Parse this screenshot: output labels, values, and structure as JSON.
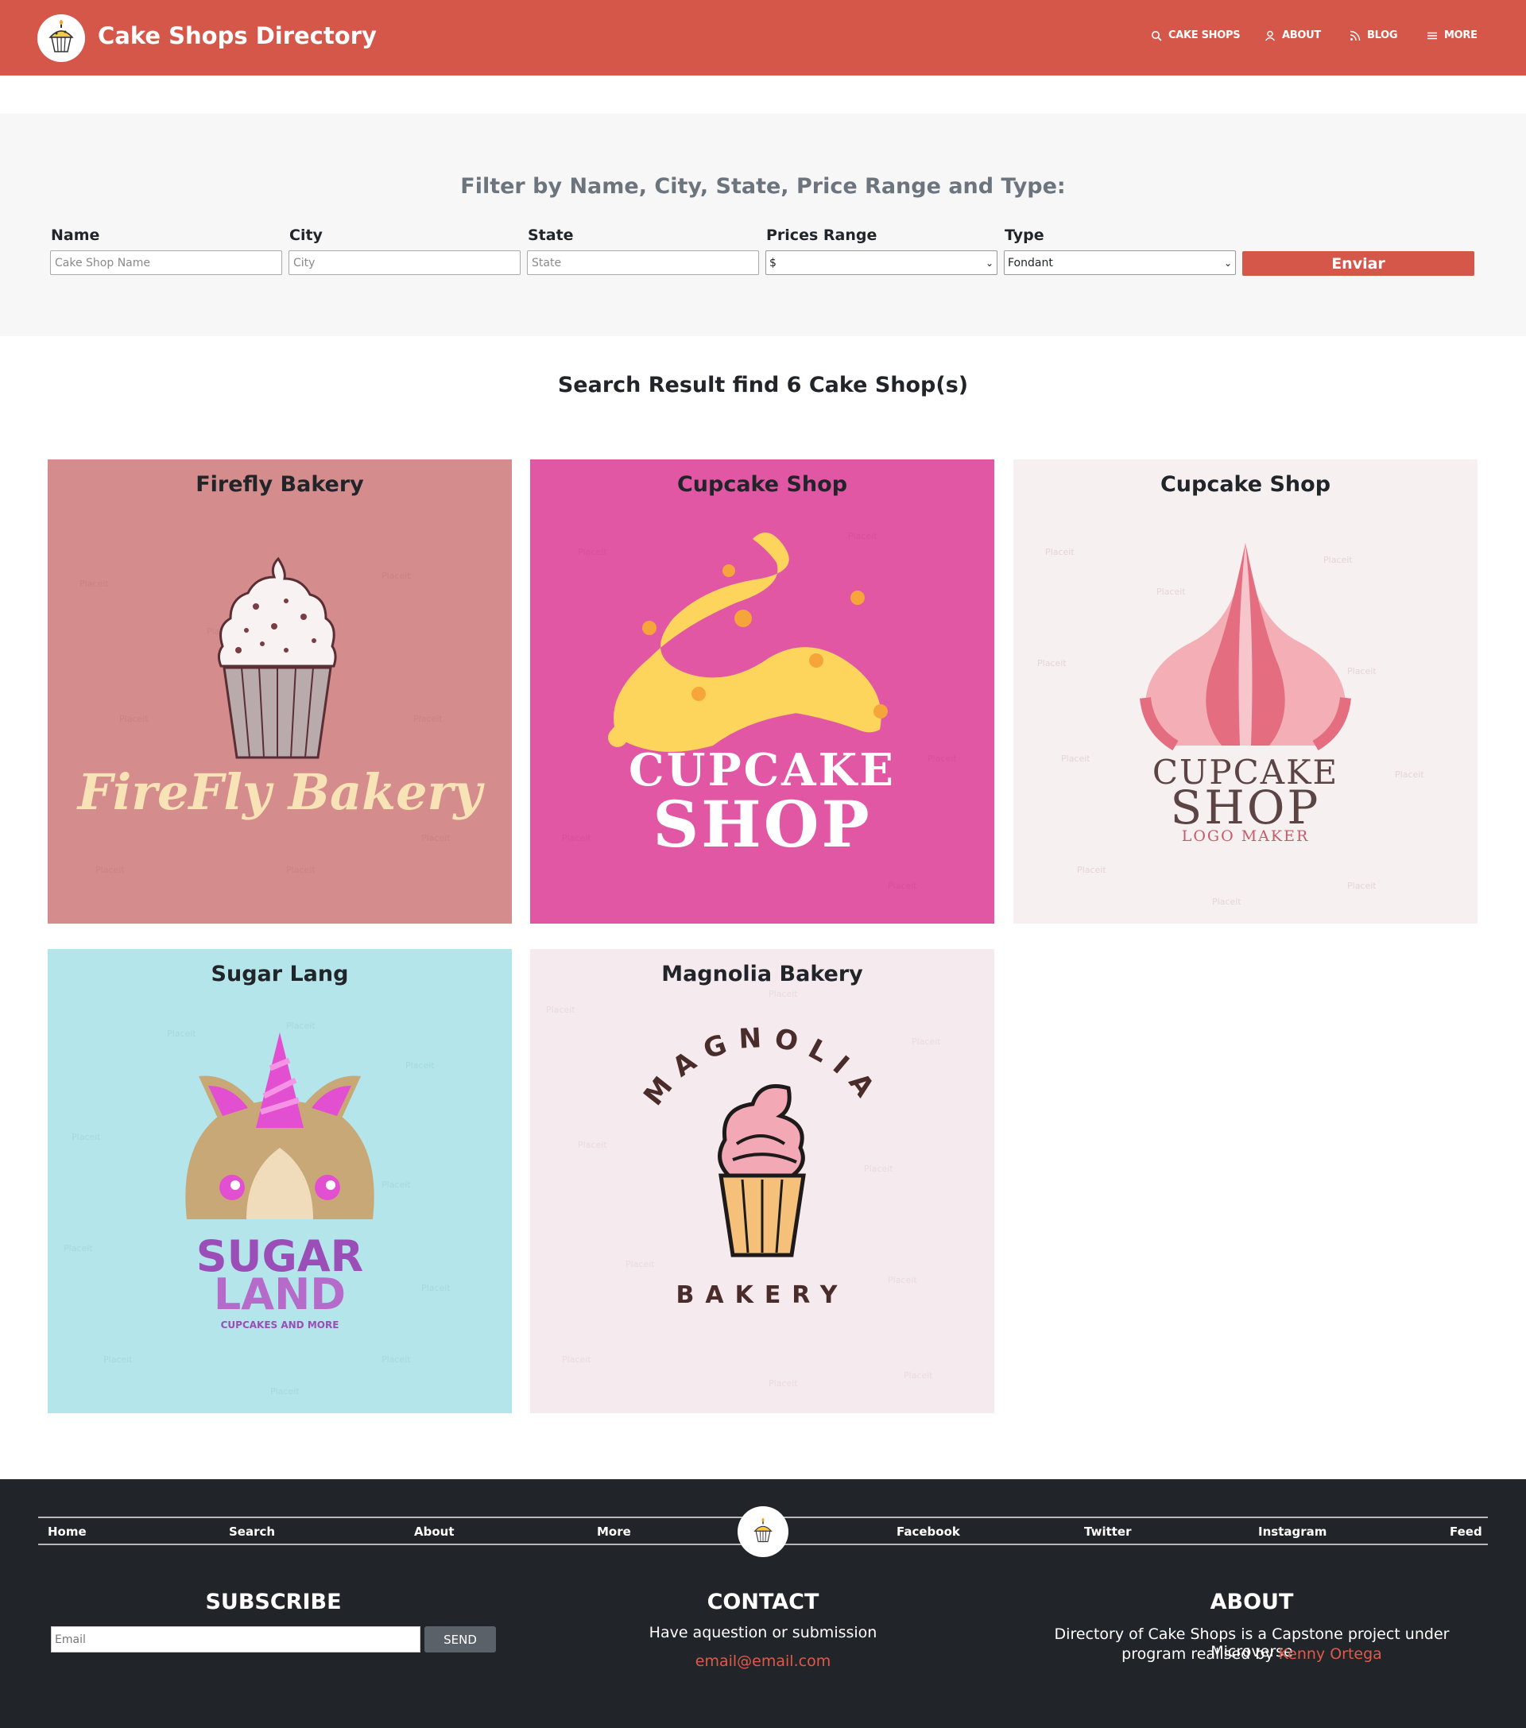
{
  "navbar": {
    "brand_title": "Cake Shops Directory",
    "items": [
      {
        "label": "CAKE SHOPS",
        "icon": "search-icon"
      },
      {
        "label": "ABOUT",
        "icon": "user-icon"
      },
      {
        "label": "BLOG",
        "icon": "rss-icon"
      },
      {
        "label": "MORE",
        "icon": "menu-icon"
      }
    ]
  },
  "filter": {
    "title": "Filter by Name, City, State, Price Range and Type:",
    "fields": {
      "name": {
        "label": "Name",
        "placeholder": "Cake Shop Name"
      },
      "city": {
        "label": "City",
        "placeholder": "City"
      },
      "state": {
        "label": "State",
        "placeholder": "State"
      },
      "price": {
        "label": "Prices Range",
        "selected": "$"
      },
      "type": {
        "label": "Type",
        "selected": "Fondant"
      }
    },
    "submit_label": "Enviar"
  },
  "results": {
    "title": "Search Result find 6 Cake Shop(s)",
    "cards": [
      {
        "name": "Firefly Bakery",
        "logo_text": "FireFly Bakery",
        "bg": "#d48c8c"
      },
      {
        "name": "Cupcake Shop",
        "logo_line1": "CUPCAKE",
        "logo_line2": "SHOP",
        "bg": "#e157a4"
      },
      {
        "name": "Cupcake Shop",
        "logo_line1": "CUPCAKE",
        "logo_line2": "SHOP",
        "logo_line3": "LOGO MAKER",
        "bg": "#f6f0f0"
      },
      {
        "name": "Sugar Lang",
        "logo_line1": "SUGAR",
        "logo_line2": "LAND",
        "logo_line3": "CUPCAKES AND MORE",
        "bg": "#b3e5ea"
      },
      {
        "name": "Magnolia Bakery",
        "logo_line1": "MAGNOLIA",
        "logo_line2": "BAKERY",
        "bg": "#f5eaee"
      }
    ],
    "watermark": "Placeit"
  },
  "footer": {
    "links_left": [
      "Home",
      "Search",
      "About",
      "More"
    ],
    "links_right": [
      "Facebook",
      "Twitter",
      "Instagram",
      "Feed"
    ],
    "subscribe": {
      "heading": "SUBSCRIBE",
      "placeholder": "Email",
      "button": "SEND"
    },
    "contact": {
      "heading": "CONTACT",
      "text": "Have aquestion or submission",
      "email": "email@email.com"
    },
    "about": {
      "heading": "ABOUT",
      "text_line1": "Directory of Cake Shops is a Capstone project under Microverse",
      "text_line2": "program realised by",
      "author": "Kenny Ortega"
    }
  },
  "colors": {
    "brand": "#d5574a",
    "footer_bg": "#212428",
    "link_accent": "#e05a4a"
  }
}
